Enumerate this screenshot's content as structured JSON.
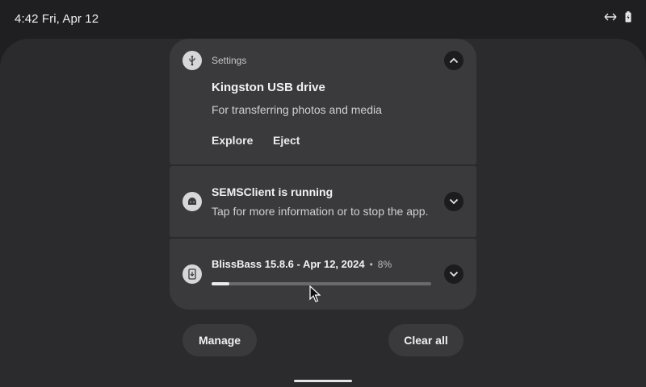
{
  "status_bar": {
    "time_date": "4:42 Fri, Apr 12",
    "icons": [
      "link-arrows-icon",
      "battery-icon"
    ]
  },
  "notifications": [
    {
      "app_label": "Settings",
      "icon": "usb-icon",
      "title": "Kingston USB drive",
      "text": "For transferring photos and media",
      "actions": [
        "Explore",
        "Eject"
      ],
      "expanded": true
    },
    {
      "icon": "android-icon",
      "title": "SEMSClient is running",
      "text": "Tap for more information or to stop the app.",
      "expanded": false
    },
    {
      "icon": "download-phone-icon",
      "title": "BlissBass 15.8.6 - Apr 12, 2024",
      "separator": "•",
      "percent_label": "8%",
      "progress": 0.08,
      "expanded": false
    }
  ],
  "footer": {
    "manage_label": "Manage",
    "clear_all_label": "Clear all"
  },
  "colors": {
    "background": "#1f1f21",
    "shade": "#2b2b2e",
    "card": "#3a3a3d",
    "accent_text": "#f1f1f3"
  }
}
